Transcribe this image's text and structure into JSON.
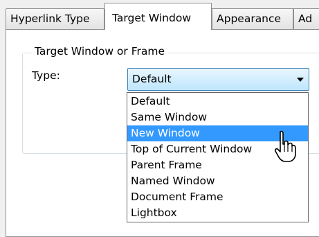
{
  "tabs": [
    {
      "label": "Hyperlink Type"
    },
    {
      "label": "Target Window"
    },
    {
      "label": "Appearance"
    },
    {
      "label": "Ad"
    }
  ],
  "group": {
    "legend": "Target Window or Frame"
  },
  "type_field": {
    "label": "Type:",
    "value": "Default",
    "options": [
      {
        "label": "Default"
      },
      {
        "label": "Same Window"
      },
      {
        "label": "New Window"
      },
      {
        "label": "Top of Current Window"
      },
      {
        "label": "Parent Frame"
      },
      {
        "label": "Named Window"
      },
      {
        "label": "Document Frame"
      },
      {
        "label": "Lightbox"
      }
    ],
    "highlighted": "New Window"
  },
  "colors": {
    "highlight": "#3399ff",
    "combo_border": "#3c7fb1"
  }
}
